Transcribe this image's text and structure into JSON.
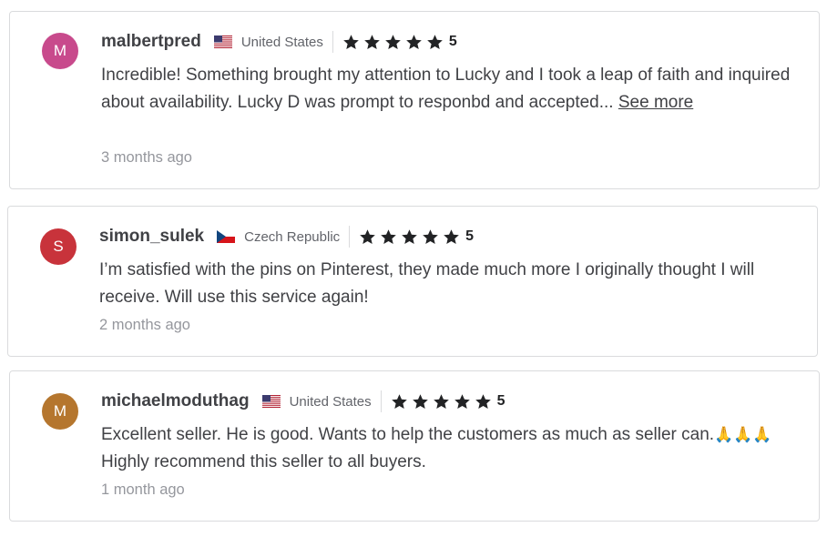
{
  "reviews": [
    {
      "avatar_initial": "M",
      "avatar_color": "#c84a8c",
      "username": "malbertpred",
      "country_flag": "us-flag-icon",
      "country": "United States",
      "rating": "5",
      "text": "Incredible! Something brought my attention to Lucky and I took a leap of faith and inquired about availability. Lucky D was prompt to responbd and accepted...",
      "see_more": "See more",
      "time": "3 months ago"
    },
    {
      "avatar_initial": "S",
      "avatar_color": "#c8333b",
      "username": "simon_sulek",
      "country_flag": "cz-flag-icon",
      "country": "Czech Republic",
      "rating": "5",
      "text": "I’m satisfied with the pins on Pinterest, they made much more I originally thought I will receive. Will use this service again!",
      "time": "2 months ago"
    },
    {
      "avatar_initial": "M",
      "avatar_color": "#b5762e",
      "username": "michaelmoduthag",
      "country_flag": "us-flag-icon",
      "country": "United States",
      "rating": "5",
      "text_before": "Excellent seller. He is good. Wants to help the customers as much as seller can.",
      "emoji": "🙏🙏🙏",
      "text_after": "Highly recommend this seller to all buyers.",
      "time": "1 month ago"
    }
  ]
}
